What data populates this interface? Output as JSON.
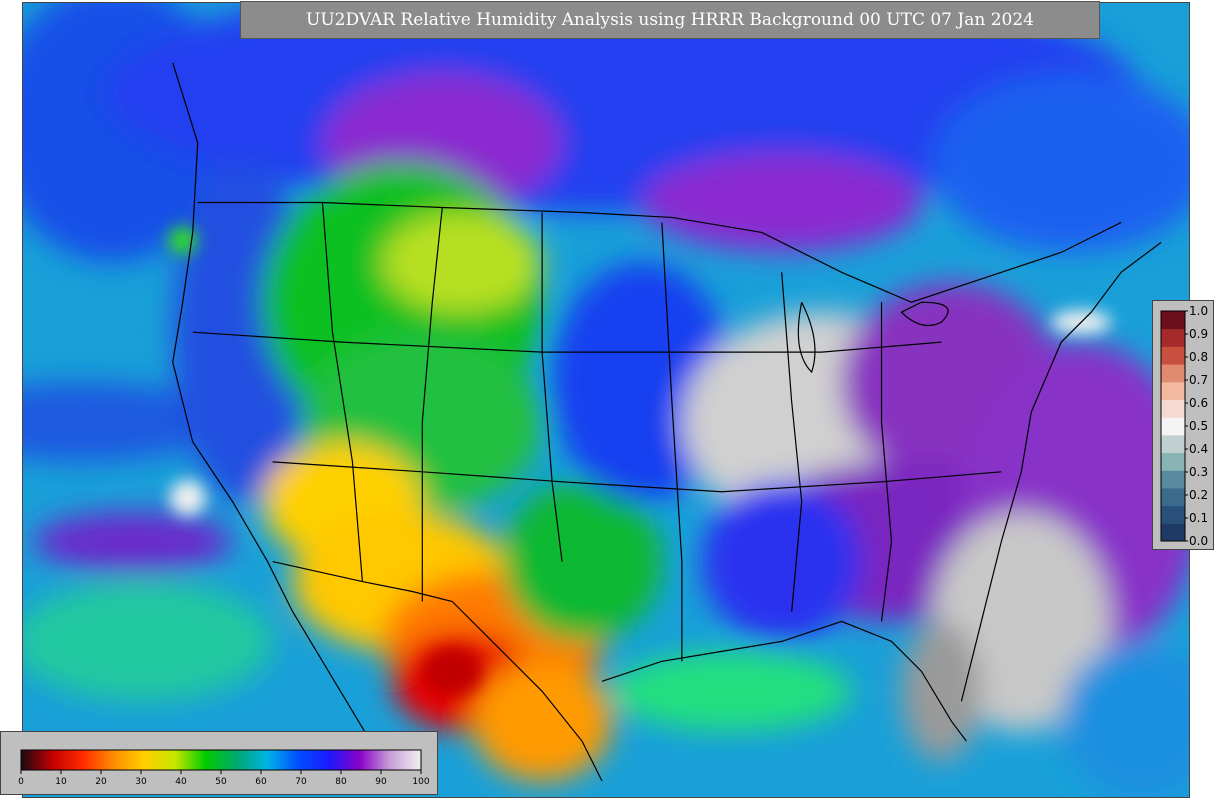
{
  "title": "UU2DVAR Relative Humidity Analysis using HRRR Background 00 UTC 07 Jan 2024",
  "rh_colorbar": {
    "ticks": [
      "0",
      "10",
      "20",
      "30",
      "40",
      "50",
      "60",
      "70",
      "80",
      "90",
      "100"
    ],
    "min": 0,
    "max": 100,
    "stops": [
      "#1a0a12",
      "#c00000",
      "#ff2a00",
      "#ff8c00",
      "#ffd000",
      "#c8e600",
      "#00cc00",
      "#00a86b",
      "#00b4e6",
      "#0050ff",
      "#1a1aff",
      "#8a00c8",
      "#c8a0d8",
      "#f0f0f0"
    ]
  },
  "value_colorbar": {
    "ticks": [
      "1.0",
      "0.9",
      "0.8",
      "0.7",
      "0.6",
      "0.5",
      "0.4",
      "0.3",
      "0.2",
      "0.1",
      "0.0"
    ],
    "min": 0.0,
    "max": 1.0,
    "colors": [
      "#1f3a64",
      "#28507a",
      "#3a6a8c",
      "#5a8aa0",
      "#8ab4b4",
      "#c0d0d0",
      "#f4f4f4",
      "#f6dad0",
      "#f2b9a0",
      "#e08a70",
      "#c8503e",
      "#a52a2a",
      "#6b0f1a"
    ]
  },
  "colors": {
    "ocean": "#1e9ad8",
    "ocean_humid": "#2468e8",
    "dry_core": "#e80000",
    "moist_core": "#c8c8c8",
    "border_line": "#000000",
    "title_bg": "#8c8c8c"
  }
}
